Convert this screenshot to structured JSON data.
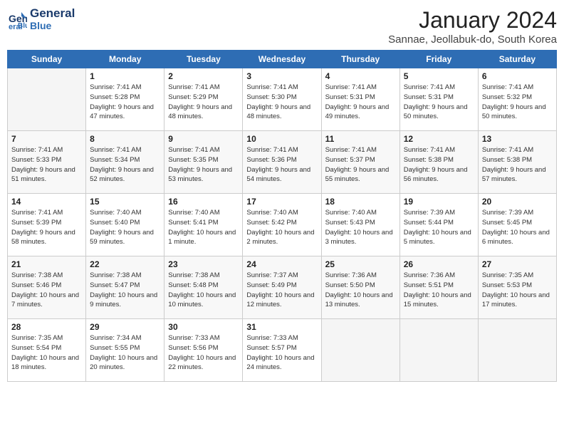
{
  "header": {
    "logo_line1": "General",
    "logo_line2": "Blue",
    "title": "January 2024",
    "location": "Sannae, Jeollabuk-do, South Korea"
  },
  "days_of_week": [
    "Sunday",
    "Monday",
    "Tuesday",
    "Wednesday",
    "Thursday",
    "Friday",
    "Saturday"
  ],
  "weeks": [
    [
      {
        "num": "",
        "empty": true
      },
      {
        "num": "1",
        "sunrise": "7:41 AM",
        "sunset": "5:28 PM",
        "daylight": "9 hours and 47 minutes."
      },
      {
        "num": "2",
        "sunrise": "7:41 AM",
        "sunset": "5:29 PM",
        "daylight": "9 hours and 48 minutes."
      },
      {
        "num": "3",
        "sunrise": "7:41 AM",
        "sunset": "5:30 PM",
        "daylight": "9 hours and 48 minutes."
      },
      {
        "num": "4",
        "sunrise": "7:41 AM",
        "sunset": "5:31 PM",
        "daylight": "9 hours and 49 minutes."
      },
      {
        "num": "5",
        "sunrise": "7:41 AM",
        "sunset": "5:31 PM",
        "daylight": "9 hours and 50 minutes."
      },
      {
        "num": "6",
        "sunrise": "7:41 AM",
        "sunset": "5:32 PM",
        "daylight": "9 hours and 50 minutes."
      }
    ],
    [
      {
        "num": "7",
        "sunrise": "7:41 AM",
        "sunset": "5:33 PM",
        "daylight": "9 hours and 51 minutes."
      },
      {
        "num": "8",
        "sunrise": "7:41 AM",
        "sunset": "5:34 PM",
        "daylight": "9 hours and 52 minutes."
      },
      {
        "num": "9",
        "sunrise": "7:41 AM",
        "sunset": "5:35 PM",
        "daylight": "9 hours and 53 minutes."
      },
      {
        "num": "10",
        "sunrise": "7:41 AM",
        "sunset": "5:36 PM",
        "daylight": "9 hours and 54 minutes."
      },
      {
        "num": "11",
        "sunrise": "7:41 AM",
        "sunset": "5:37 PM",
        "daylight": "9 hours and 55 minutes."
      },
      {
        "num": "12",
        "sunrise": "7:41 AM",
        "sunset": "5:38 PM",
        "daylight": "9 hours and 56 minutes."
      },
      {
        "num": "13",
        "sunrise": "7:41 AM",
        "sunset": "5:38 PM",
        "daylight": "9 hours and 57 minutes."
      }
    ],
    [
      {
        "num": "14",
        "sunrise": "7:41 AM",
        "sunset": "5:39 PM",
        "daylight": "9 hours and 58 minutes."
      },
      {
        "num": "15",
        "sunrise": "7:40 AM",
        "sunset": "5:40 PM",
        "daylight": "9 hours and 59 minutes."
      },
      {
        "num": "16",
        "sunrise": "7:40 AM",
        "sunset": "5:41 PM",
        "daylight": "10 hours and 1 minute."
      },
      {
        "num": "17",
        "sunrise": "7:40 AM",
        "sunset": "5:42 PM",
        "daylight": "10 hours and 2 minutes."
      },
      {
        "num": "18",
        "sunrise": "7:40 AM",
        "sunset": "5:43 PM",
        "daylight": "10 hours and 3 minutes."
      },
      {
        "num": "19",
        "sunrise": "7:39 AM",
        "sunset": "5:44 PM",
        "daylight": "10 hours and 5 minutes."
      },
      {
        "num": "20",
        "sunrise": "7:39 AM",
        "sunset": "5:45 PM",
        "daylight": "10 hours and 6 minutes."
      }
    ],
    [
      {
        "num": "21",
        "sunrise": "7:38 AM",
        "sunset": "5:46 PM",
        "daylight": "10 hours and 7 minutes."
      },
      {
        "num": "22",
        "sunrise": "7:38 AM",
        "sunset": "5:47 PM",
        "daylight": "10 hours and 9 minutes."
      },
      {
        "num": "23",
        "sunrise": "7:38 AM",
        "sunset": "5:48 PM",
        "daylight": "10 hours and 10 minutes."
      },
      {
        "num": "24",
        "sunrise": "7:37 AM",
        "sunset": "5:49 PM",
        "daylight": "10 hours and 12 minutes."
      },
      {
        "num": "25",
        "sunrise": "7:36 AM",
        "sunset": "5:50 PM",
        "daylight": "10 hours and 13 minutes."
      },
      {
        "num": "26",
        "sunrise": "7:36 AM",
        "sunset": "5:51 PM",
        "daylight": "10 hours and 15 minutes."
      },
      {
        "num": "27",
        "sunrise": "7:35 AM",
        "sunset": "5:53 PM",
        "daylight": "10 hours and 17 minutes."
      }
    ],
    [
      {
        "num": "28",
        "sunrise": "7:35 AM",
        "sunset": "5:54 PM",
        "daylight": "10 hours and 18 minutes."
      },
      {
        "num": "29",
        "sunrise": "7:34 AM",
        "sunset": "5:55 PM",
        "daylight": "10 hours and 20 minutes."
      },
      {
        "num": "30",
        "sunrise": "7:33 AM",
        "sunset": "5:56 PM",
        "daylight": "10 hours and 22 minutes."
      },
      {
        "num": "31",
        "sunrise": "7:33 AM",
        "sunset": "5:57 PM",
        "daylight": "10 hours and 24 minutes."
      },
      {
        "num": "",
        "empty": true
      },
      {
        "num": "",
        "empty": true
      },
      {
        "num": "",
        "empty": true
      }
    ]
  ]
}
